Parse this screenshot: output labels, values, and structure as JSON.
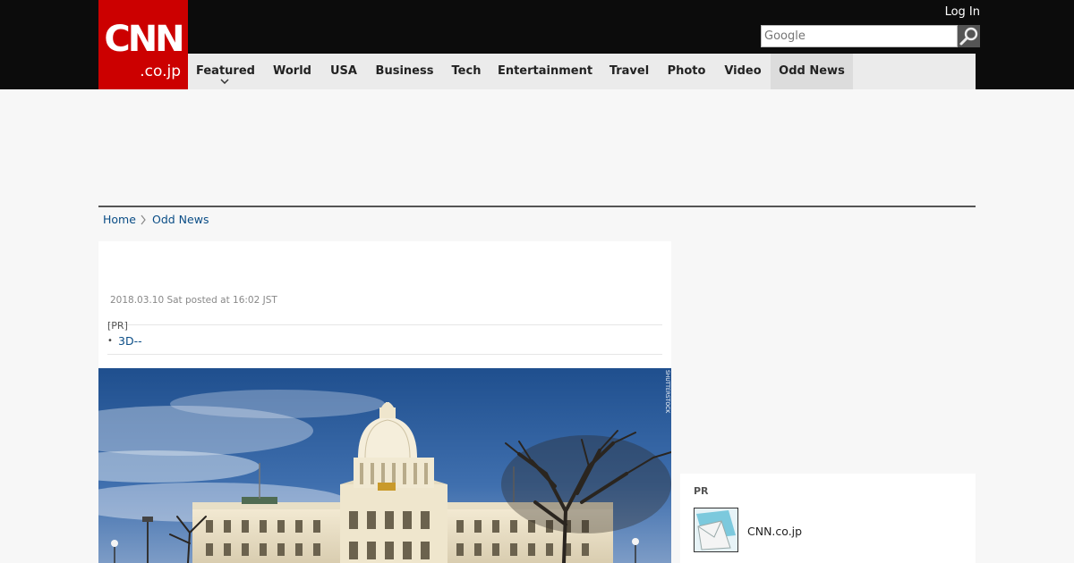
{
  "header": {
    "logo_text": "CNN",
    "logo_subtext": ".co.jp",
    "login_label": "Log In",
    "search_placeholder": "Google",
    "colors": {
      "brand_red": "#cc0000",
      "topbar": "#0c0c0c",
      "nav_bg": "#ebebeb",
      "link": "#0a4d86"
    }
  },
  "nav": {
    "items": [
      {
        "label": "Featured",
        "has_dropdown": true
      },
      {
        "label": "World"
      },
      {
        "label": "USA"
      },
      {
        "label": "Business"
      },
      {
        "label": "Tech"
      },
      {
        "label": "Entertainment"
      },
      {
        "label": "Travel"
      },
      {
        "label": "Photo"
      },
      {
        "label": "Video"
      },
      {
        "label": "Odd News",
        "active": true
      }
    ],
    "dropdown_icon": "chevron-down-icon"
  },
  "breadcrumb": {
    "home": "Home",
    "separator_icon": "chevron-right-icon",
    "current": "Odd News"
  },
  "article": {
    "date": "2018.03.10 Sat posted at 16:02 JST",
    "pr_label": "[PR]",
    "pr_link": "3D--",
    "image_credit": "SHUTTERSTOCK"
  },
  "sidebar": {
    "pr_label": "PR",
    "pr_item_title": "CNN.co.jp"
  }
}
